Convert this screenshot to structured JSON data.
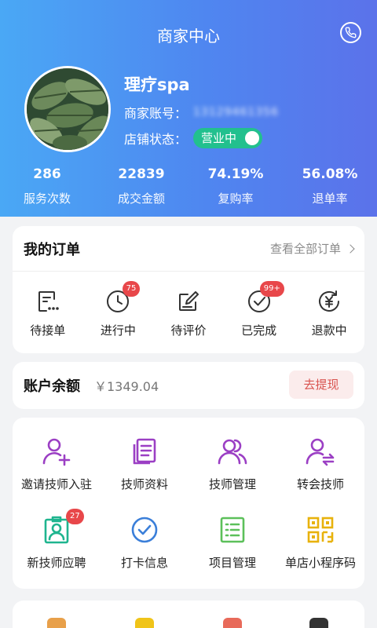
{
  "header": {
    "title": "商家中心",
    "store_name": "理疗spa",
    "account_label": "商家账号：",
    "account_value": "13129461356",
    "status_label": "店铺状态：",
    "status_value": "营业中",
    "status_on": true,
    "gradient_colors": [
      "#4aa8f5",
      "#5b72ea"
    ]
  },
  "stats": [
    {
      "value": "286",
      "label": "服务次数"
    },
    {
      "value": "22839",
      "label": "成交金额"
    },
    {
      "value": "74.19%",
      "label": "复购率"
    },
    {
      "value": "56.08%",
      "label": "退单率"
    }
  ],
  "orders": {
    "title": "我的订单",
    "view_all": "查看全部订单",
    "items": [
      {
        "label": "待接单",
        "badge": ""
      },
      {
        "label": "进行中",
        "badge": "75"
      },
      {
        "label": "待评价",
        "badge": ""
      },
      {
        "label": "已完成",
        "badge": "99+"
      },
      {
        "label": "退款中",
        "badge": ""
      }
    ]
  },
  "balance": {
    "title": "账户余额",
    "value": "￥1349.04",
    "withdraw": "去提现"
  },
  "tools": [
    {
      "label": "邀请技师入驻",
      "icon": "user-add-icon",
      "color": "#9b3fc4",
      "badge": ""
    },
    {
      "label": "技师资料",
      "icon": "documents-icon",
      "color": "#9b3fc4",
      "badge": ""
    },
    {
      "label": "技师管理",
      "icon": "users-icon",
      "color": "#9b3fc4",
      "badge": ""
    },
    {
      "label": "转会技师",
      "icon": "user-transfer-icon",
      "color": "#9b3fc4",
      "badge": ""
    },
    {
      "label": "新技师应聘",
      "icon": "badge-id-icon",
      "color": "#1fb58f",
      "badge": "27"
    },
    {
      "label": "打卡信息",
      "icon": "check-circle-icon",
      "color": "#3b7fd9",
      "badge": ""
    },
    {
      "label": "项目管理",
      "icon": "list-icon",
      "color": "#5cc05a",
      "badge": ""
    },
    {
      "label": "单店小程序码",
      "icon": "qrcode-icon",
      "color": "#e8b20c",
      "badge": ""
    }
  ],
  "accent": {
    "badge": "#e8474a",
    "toggle": "#22c08e",
    "withdraw_text": "#d9534f"
  }
}
